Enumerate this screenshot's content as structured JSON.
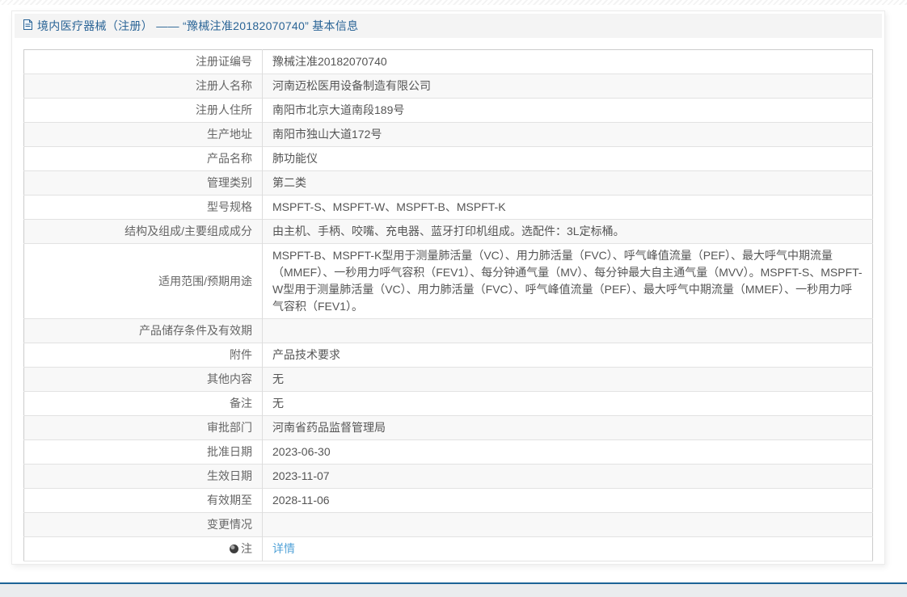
{
  "page": {
    "title": "境内医疗器械（注册） —— “豫械注准20182070740” 基本信息"
  },
  "table": {
    "rows": [
      {
        "label": "注册证编号",
        "value": "豫械注准20182070740"
      },
      {
        "label": "注册人名称",
        "value": "河南迈松医用设备制造有限公司"
      },
      {
        "label": "注册人住所",
        "value": "南阳市北京大道南段189号"
      },
      {
        "label": "生产地址",
        "value": "南阳市独山大道172号"
      },
      {
        "label": "产品名称",
        "value": "肺功能仪"
      },
      {
        "label": "管理类别",
        "value": "第二类"
      },
      {
        "label": "型号规格",
        "value": "MSPFT-S、MSPFT-W、MSPFT-B、MSPFT-K"
      },
      {
        "label": "结构及组成/主要组成成分",
        "value": "由主机、手柄、咬嘴、充电器、蓝牙打印机组成。选配件：3L定标桶。"
      },
      {
        "label": "适用范围/预期用途",
        "value": "MSPFT-B、MSPFT-K型用于测量肺活量（VC）、用力肺活量（FVC）、呼气峰值流量（PEF）、最大呼气中期流量（MMEF）、一秒用力呼气容积（FEV1）、每分钟通气量（MV）、每分钟最大自主通气量（MVV）。MSPFT-S、MSPFT-W型用于测量肺活量（VC）、用力肺活量（FVC）、呼气峰值流量（PEF）、最大呼气中期流量（MMEF）、一秒用力呼气容积（FEV1）。"
      },
      {
        "label": "产品储存条件及有效期",
        "value": ""
      },
      {
        "label": "附件",
        "value": "产品技术要求"
      },
      {
        "label": "其他内容",
        "value": "无"
      },
      {
        "label": "备注",
        "value": "无"
      },
      {
        "label": "审批部门",
        "value": "河南省药品监督管理局"
      },
      {
        "label": "批准日期",
        "value": "2023-06-30"
      },
      {
        "label": "生效日期",
        "value": "2023-11-07"
      },
      {
        "label": "有效期至",
        "value": "2028-11-06"
      },
      {
        "label": "变更情况",
        "value": ""
      },
      {
        "label": "注",
        "value": "详情",
        "link": true,
        "icon": "note-circle-icon"
      }
    ]
  },
  "colors": {
    "title_text": "#2a6496",
    "link": "#53a3d8",
    "footer_line": "#1d6396",
    "row_alt_bg": "#f8f8f8"
  }
}
